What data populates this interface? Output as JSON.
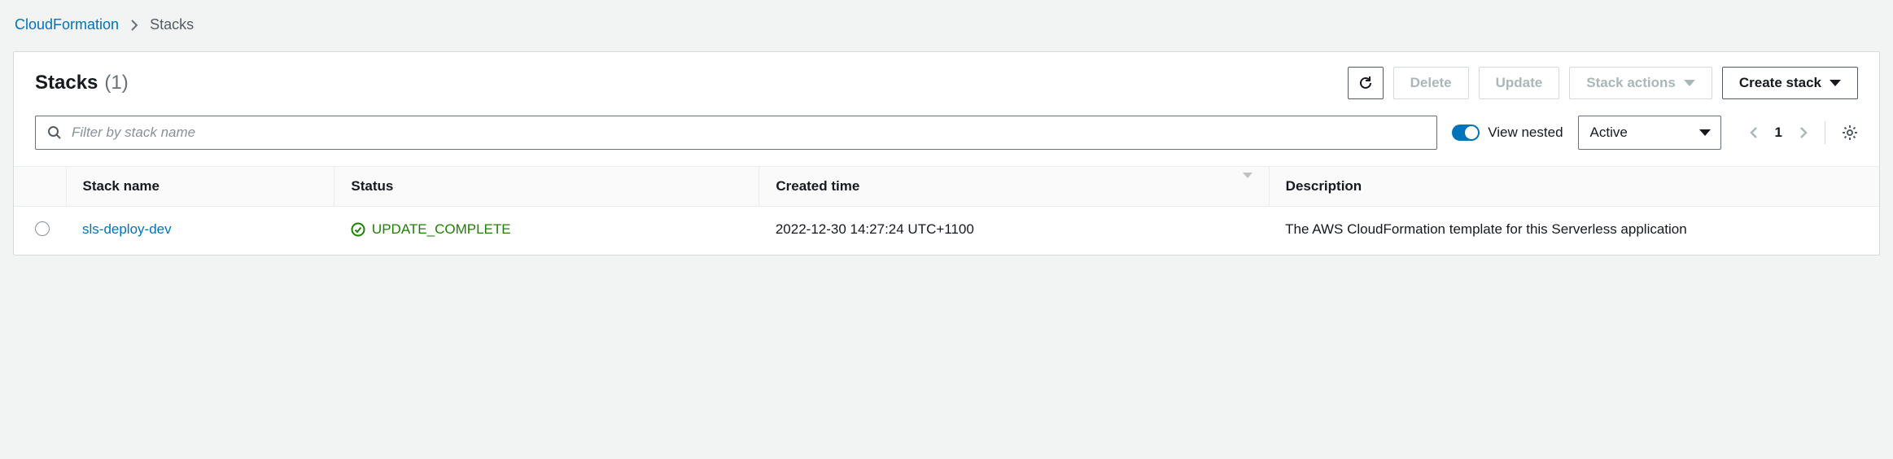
{
  "breadcrumb": {
    "root": "CloudFormation",
    "current": "Stacks"
  },
  "header": {
    "title": "Stacks",
    "count": "(1)"
  },
  "actions": {
    "delete": "Delete",
    "update": "Update",
    "stack_actions": "Stack actions",
    "create_stack": "Create stack"
  },
  "filter": {
    "placeholder": "Filter by stack name",
    "view_nested": "View nested",
    "status_select": "Active"
  },
  "pagination": {
    "page": "1"
  },
  "table": {
    "columns": {
      "stack_name": "Stack name",
      "status": "Status",
      "created_time": "Created time",
      "description": "Description"
    },
    "rows": [
      {
        "stack_name": "sls-deploy-dev",
        "status": "UPDATE_COMPLETE",
        "created_time": "2022-12-30 14:27:24 UTC+1100",
        "description": "The AWS CloudFormation template for this Serverless application"
      }
    ]
  }
}
